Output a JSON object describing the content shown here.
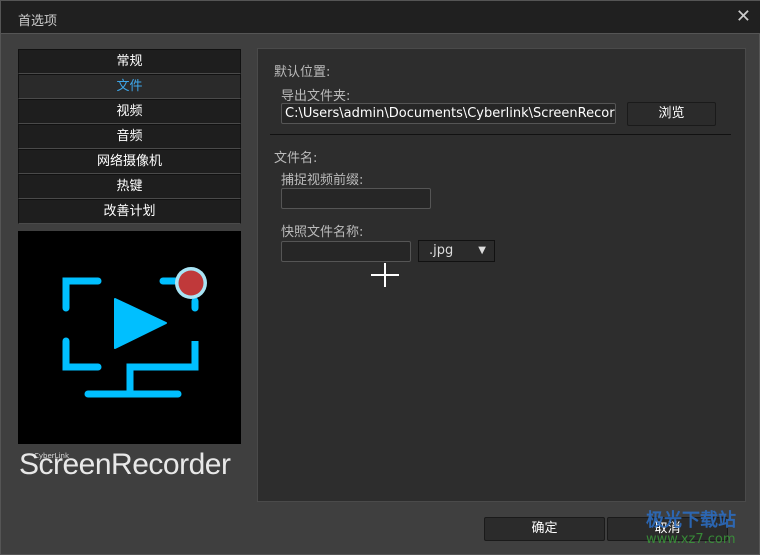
{
  "window": {
    "title": "首选项",
    "close_icon": "close-icon"
  },
  "nav": {
    "items": [
      {
        "label": "常规"
      },
      {
        "label": "文件",
        "active": true
      },
      {
        "label": "视频"
      },
      {
        "label": "音频"
      },
      {
        "label": "网络摄像机"
      },
      {
        "label": "热键"
      },
      {
        "label": "改善计划"
      }
    ]
  },
  "brand": {
    "small": "CyberLink",
    "name": "ScreenRecorder",
    "colors": {
      "accent": "#00bfff",
      "record": "#c0393a"
    }
  },
  "panel": {
    "default_location_label": "默认位置:",
    "export_folder_label": "导出文件夹:",
    "export_folder_value": "C:\\Users\\admin\\Documents\\Cyberlink\\ScreenRecorde",
    "browse_label": "浏览",
    "filename_label": "文件名:",
    "video_prefix_label": "捕捉视频前缀:",
    "video_prefix_value": "",
    "snapshot_name_label": "快照文件名称:",
    "snapshot_name_value": "",
    "snapshot_format": ".jpg"
  },
  "footer": {
    "ok_label": "确定",
    "cancel_label": "取消"
  },
  "watermark": {
    "text": "极光下载站",
    "url": "www.xz7.com"
  }
}
